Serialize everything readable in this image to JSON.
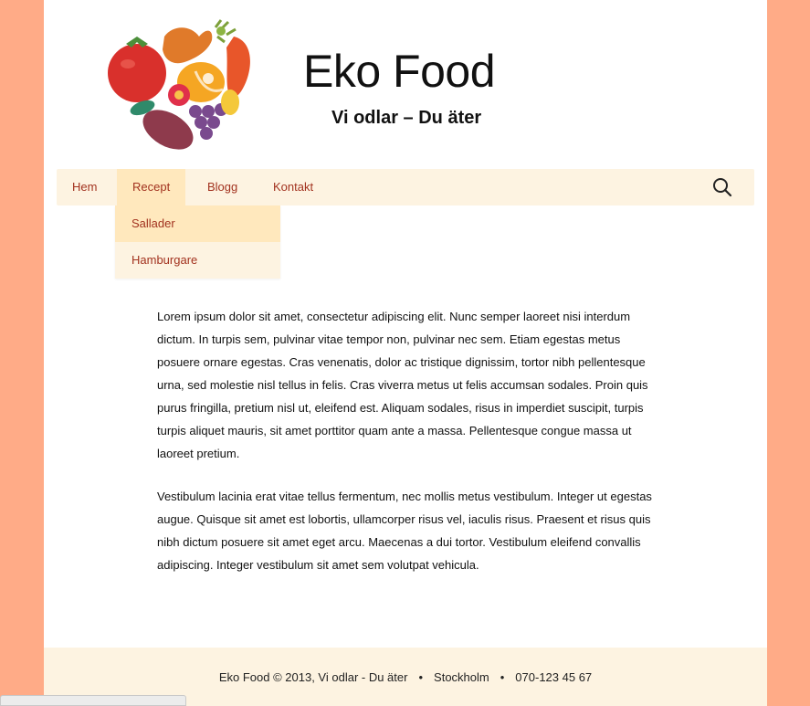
{
  "site": {
    "title": "Eko Food",
    "description": "Vi odlar – Du äter"
  },
  "nav": {
    "items": [
      "Hem",
      "Recept",
      "Blogg",
      "Kontakt"
    ],
    "active": "Recept",
    "submenu": [
      "Sallader",
      "Hamburgare"
    ],
    "search_icon": "search-icon"
  },
  "content": {
    "paragraphs": [
      "Lorem ipsum dolor sit amet, consectetur adipiscing elit. Nunc semper laoreet nisi interdum dictum. In turpis sem, pulvinar vitae tempor non, pulvinar nec sem. Etiam egestas metus posuere ornare egestas. Cras venenatis, dolor ac tristique dignissim, tortor nibh pellentesque urna, sed molestie nisl tellus in felis. Cras viverra metus ut felis accumsan sodales. Proin quis purus fringilla, pretium nisl ut, eleifend est. Aliquam sodales, risus in imperdiet suscipit, turpis turpis aliquet mauris, sit amet porttitor quam ante a massa. Pellentesque congue massa ut laoreet pretium.",
      "Vestibulum lacinia erat vitae tellus fermentum, nec mollis metus vestibulum. Integer ut egestas augue. Quisque sit amet est lobortis, ullamcorper risus vel, iaculis risus. Praesent et risus quis nibh dictum posuere sit amet eget arcu. Maecenas a dui tortor. Vestibulum eleifend convallis adipiscing. Integer vestibulum sit amet sem volutpat vehicula."
    ]
  },
  "footer": {
    "copyright": "Eko Food © 2013, Vi odlar - Du äter",
    "city": "Stockholm",
    "phone": "070-123 45 67",
    "separator": "•"
  },
  "colors": {
    "background": "#ffab87",
    "nav_background": "#fdf3e1",
    "nav_active": "#ffe8bd",
    "link": "#a2321f"
  }
}
